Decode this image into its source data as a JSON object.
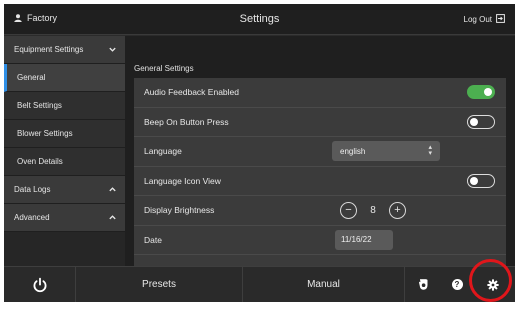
{
  "header": {
    "user_name": "Factory",
    "title": "Settings",
    "logout_label": "Log Out"
  },
  "sidebar": {
    "groups": [
      {
        "label": "Equipment Settings",
        "expanded": true
      },
      {
        "label": "Data Logs",
        "expanded": false
      },
      {
        "label": "Advanced",
        "expanded": false
      }
    ],
    "items": [
      {
        "label": "General",
        "active": true
      },
      {
        "label": "Belt Settings"
      },
      {
        "label": "Blower Settings"
      },
      {
        "label": "Oven Details"
      }
    ]
  },
  "main": {
    "section_title": "General Settings",
    "rows": {
      "audio_feedback": {
        "label": "Audio Feedback Enabled",
        "enabled": true
      },
      "beep": {
        "label": "Beep On Button Press",
        "enabled": false
      },
      "language": {
        "label": "Language",
        "value": "english"
      },
      "language_icon": {
        "label": "Language Icon View",
        "enabled": false
      },
      "brightness": {
        "label": "Display Brightness",
        "value": "8",
        "minus": "−",
        "plus": "+"
      },
      "date": {
        "label": "Date",
        "value": "11/16/22"
      }
    }
  },
  "bottombar": {
    "presets_label": "Presets",
    "manual_label": "Manual",
    "help_label": "?"
  },
  "colors": {
    "accent_blue": "#2f8fe6",
    "toggle_on": "#4caf50",
    "highlight_ring": "#e0161b"
  }
}
